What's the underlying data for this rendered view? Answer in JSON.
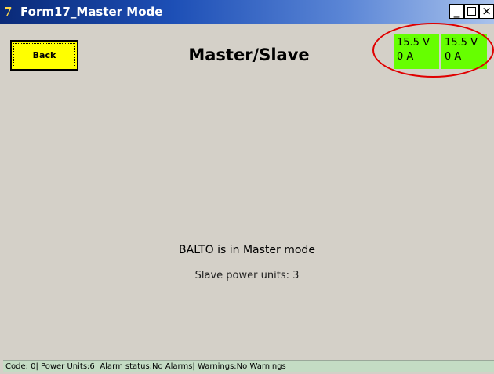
{
  "window": {
    "title": "Form17_Master Mode",
    "app_icon": "7",
    "controls": {
      "minimize": "_",
      "close": "×"
    }
  },
  "toolbar": {
    "back_label": "Back"
  },
  "page": {
    "title": "Master/Slave"
  },
  "meters": [
    {
      "voltage": "15.5 V",
      "current": "0 A"
    },
    {
      "voltage": "15.5 V",
      "current": "0 A"
    }
  ],
  "status": {
    "mode": "BALTO is in Master mode",
    "slave_units": "Slave power units: 3"
  },
  "statusbar": {
    "text": "Code: 0| Power Units:6| Alarm status:No Alarms| Warnings:No Warnings"
  },
  "colors": {
    "back_button": "#ffff00",
    "meter_bg": "#66ff00",
    "highlight": "#e00000",
    "statusbar_bg": "#c4dcc4"
  }
}
